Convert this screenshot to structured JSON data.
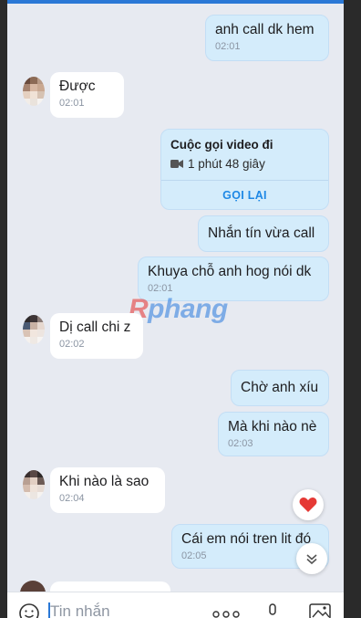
{
  "messages": [
    {
      "dir": "out",
      "text": "anh call dk hem",
      "time": "02:01"
    },
    {
      "dir": "in",
      "text": "Được",
      "time": "02:01"
    },
    {
      "dir": "call",
      "title": "Cuộc gọi video đi",
      "duration": "1 phút 48 giây",
      "action": "GỌI LẠI"
    },
    {
      "dir": "out",
      "text": "Nhắn tín vừa call",
      "time": ""
    },
    {
      "dir": "out",
      "text": "Khuya chỗ anh hog nói dk",
      "time": "02:01"
    },
    {
      "dir": "in",
      "text": "Dị call chi z",
      "time": "02:02"
    },
    {
      "dir": "out",
      "text": "Chờ anh xíu",
      "time": ""
    },
    {
      "dir": "out",
      "text": "Mà khi nào nè",
      "time": "02:03"
    },
    {
      "dir": "in",
      "text": "Khi nào là sao",
      "time": "02:04"
    },
    {
      "dir": "out",
      "text": "Cái em nói tren lit đó",
      "time": "02:05"
    }
  ],
  "watermark": {
    "part1": "R",
    "part2": "phang"
  },
  "composer": {
    "placeholder": "Tin nhắn"
  },
  "icons": {
    "emoji": "emoji-icon",
    "more": "more-icon",
    "mic": "mic-icon",
    "image": "image-icon",
    "heart": "heart-icon",
    "scroll_down": "chevron-down-icon",
    "video": "video-camera-icon"
  },
  "colors": {
    "accent": "#1e88e5",
    "outgoing_bubble": "#d4ecfb",
    "incoming_bubble": "#ffffff",
    "background": "#e7eaf1",
    "heart": "#e53935"
  }
}
